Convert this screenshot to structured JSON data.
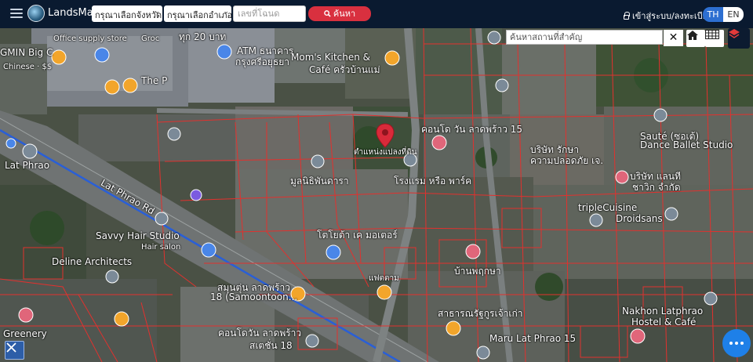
{
  "header": {
    "brand": "LandsMaps",
    "province_select": "กรุณาเลือกจังหวัด",
    "district_select": "กรุณาเลือกอำเภอ",
    "deed_placeholder": "เลขที่โฉนด",
    "search_label": "ค้นหา",
    "login_label": "เข้าสู่ระบบ/ลงทะเบียน",
    "lang_th": "TH",
    "lang_en": "EN"
  },
  "map_controls": {
    "place_search_placeholder": "ค้นหาสถานที่สำคัญ",
    "close": "✕"
  },
  "map_labels": {
    "office_supply": "Office supply store",
    "groc": "Groc",
    "bigc": "GMIN Big C",
    "chinese": "Chinese · $$",
    "price20": "ทุก 20 บาท",
    "atm": "ATM ธนาคาร",
    "atm2": "กรุงศรีอยุธยา",
    "momskitchen": "Mom's Kitchen &",
    "cafe": "Café ครัวบ้านแม่",
    "the_p": "The P",
    "lat_phrao": "Lat Phrao",
    "lat_phrao_road": "Lat Phrao Rd",
    "savvy": "Savvy Hair Studio",
    "hair": "Hair salon",
    "deline": "Deline Architects",
    "samoon": "18 (Samoontoon...",
    "greenery": "Greenery",
    "plot_position": "ตำแหน่งแปลงที่ดิน",
    "condo15": "คอนโด วัน ลาดพร้าว 15",
    "sauté": "Sauté (ซอเต้)",
    "dance": "Dance Ballet Studio",
    "triple": "tripleCuisine",
    "droidsans": "Droidsans",
    "nakhon": "Nakhon Latphrao",
    "hostel": "Hostel & Café",
    "maru": "Maru Lat Phrao 15",
    "toyota": "โตโยต้า เค มอเตอร์",
    "condo18": "คอนโดวัน ลาดพร้าว",
    "condo18b": "สเตชั่น 18",
    "samoontoon_th": "สมุนตุ่น ลาดพร้าว",
    "bangchak": "บ้านพฤกษา",
    "fattamarm": "แฟตตาม",
    "suratthani": "สาธารณรัฐกูรเจ้าเก่า",
    "hotel": "โรงแรม หรือ พาร์ค",
    "mullnithi": "มูลนิธิพันดารา",
    "safety": "บริษัท รักษา",
    "safety2": "ความปลอดภัย เจ.",
    "company": "บริษัท แลนที",
    "company2": "ชาวิก จำกัด"
  },
  "colors": {
    "header_bg": "#0a1a30",
    "search_red": "#d9303f",
    "lang_active": "#2d6fd1",
    "parcel_line": "#e2312e",
    "marker_red": "#d92a3a",
    "chat_blue": "#1e80e8"
  },
  "icons": [
    "menu-icon",
    "logo",
    "chevron-down-icon",
    "search-icon",
    "lock-icon",
    "home-icon",
    "grid-icon",
    "layers-icon",
    "close-icon",
    "map-pin-icon",
    "chat-icon",
    "tools-icon"
  ]
}
